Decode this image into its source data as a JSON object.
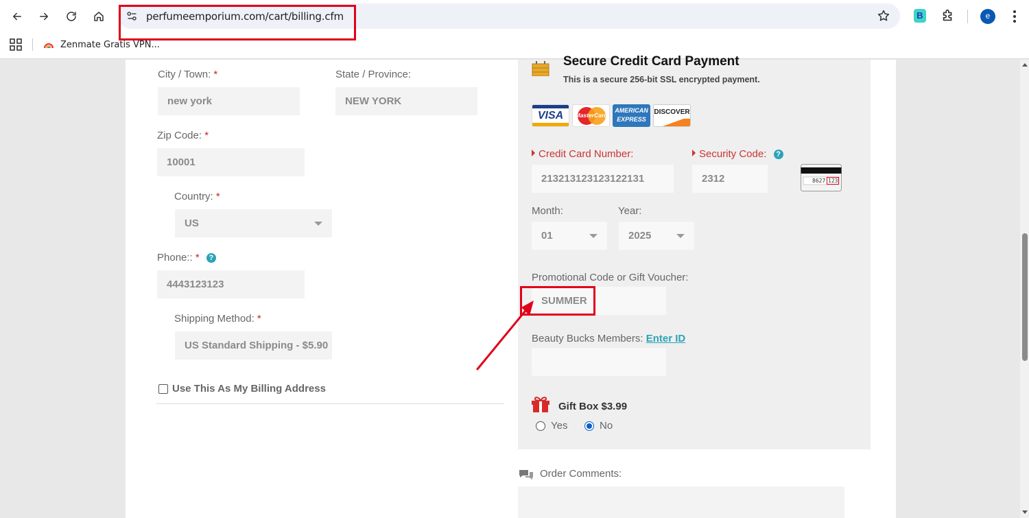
{
  "browser": {
    "url": "perfumeemporium.com/cart/billing.cfm",
    "bookmark": "Zenmate Gratis VPN...",
    "profile_initial": "e",
    "extension_label": "B"
  },
  "shipping": {
    "city_label": "City / Town:",
    "city_value": "new york",
    "state_label": "State / Province:",
    "state_value": "NEW YORK",
    "zip_label": "Zip Code:",
    "zip_value": "10001",
    "country_label": "Country:",
    "country_value": "US",
    "phone_label": "Phone::",
    "phone_value": "4443123123",
    "method_label": "Shipping Method:",
    "method_value": "US Standard Shipping - $5.90",
    "required_mark": "*",
    "billing_checkbox": "Use This As My Billing Address"
  },
  "payment": {
    "title": "Secure Credit Card Payment",
    "subtitle": "This is a secure 256-bit SSL encrypted payment.",
    "cards": [
      "VISA",
      "MasterCard",
      "AMERICAN EXPRESS",
      "DISCOVER"
    ],
    "cc_label": "Credit Card Number:",
    "cc_value": "213213123123122131",
    "cvv_label": "Security Code:",
    "cvv_value": "2312",
    "cvv_example_digits": "8627",
    "cvv_example_code": "123",
    "month_label": "Month:",
    "month_value": "01",
    "year_label": "Year:",
    "year_value": "2025",
    "promo_label": "Promotional Code or Gift Voucher:",
    "promo_value": "SUMMER",
    "beauty_label": "Beauty Bucks Members:",
    "beauty_link": "Enter ID",
    "beauty_value": "",
    "gift_label": "Gift Box $3.99",
    "gift_yes": "Yes",
    "gift_no": "No",
    "gift_selected": "No"
  },
  "comments": {
    "label": "Order Comments:"
  },
  "colors": {
    "annotation_red": "#e0001a",
    "required_red": "#cc2222",
    "accent_teal": "#2aa3b8"
  }
}
